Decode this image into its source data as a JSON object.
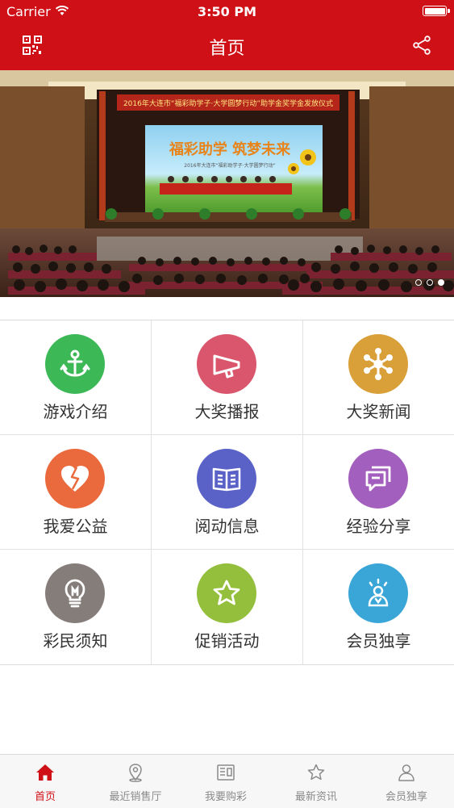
{
  "status_bar": {
    "carrier": "Carrier",
    "time": "3:50 PM"
  },
  "header": {
    "title": "首页"
  },
  "banner": {
    "stage_title": "2016年大连市“福彩助学子·大学圆梦行动”助学金奖学金发放仪式",
    "screen_slogan": "福彩助学 筑梦未来",
    "screen_caption": "2016年大连市“福彩助学子·大学圆梦行动”",
    "carousel": {
      "count": 3,
      "active": 3
    }
  },
  "grid": {
    "items": [
      {
        "label": "游戏介绍",
        "icon": "anchor-icon",
        "color": "#3cb857"
      },
      {
        "label": "大奖播报",
        "icon": "megaphone-icon",
        "color": "#d9566c"
      },
      {
        "label": "大奖新闻",
        "icon": "asterisk-icon",
        "color": "#d9a03a"
      },
      {
        "label": "我爱公益",
        "icon": "heart-icon",
        "color": "#ea6a3d"
      },
      {
        "label": "阅动信息",
        "icon": "book-icon",
        "color": "#5a62c8"
      },
      {
        "label": "经验分享",
        "icon": "chat-icon",
        "color": "#a35fbd"
      },
      {
        "label": "彩民须知",
        "icon": "lightbulb-icon",
        "color": "#857d7a"
      },
      {
        "label": "促销活动",
        "icon": "star-icon",
        "color": "#94bf3d"
      },
      {
        "label": "会员独享",
        "icon": "member-icon",
        "color": "#3aa6d8"
      }
    ]
  },
  "tabbar": {
    "items": [
      {
        "label": "首页",
        "icon": "home-icon",
        "active": true
      },
      {
        "label": "最近销售厅",
        "icon": "location-pin-icon",
        "active": false
      },
      {
        "label": "我要购彩",
        "icon": "ticket-icon",
        "active": false
      },
      {
        "label": "最新资讯",
        "icon": "star-outline-icon",
        "active": false
      },
      {
        "label": "会员独享",
        "icon": "user-icon",
        "active": false
      }
    ]
  },
  "colors": {
    "brand_red": "#cf1016",
    "tab_inactive": "#8a8a8a"
  }
}
